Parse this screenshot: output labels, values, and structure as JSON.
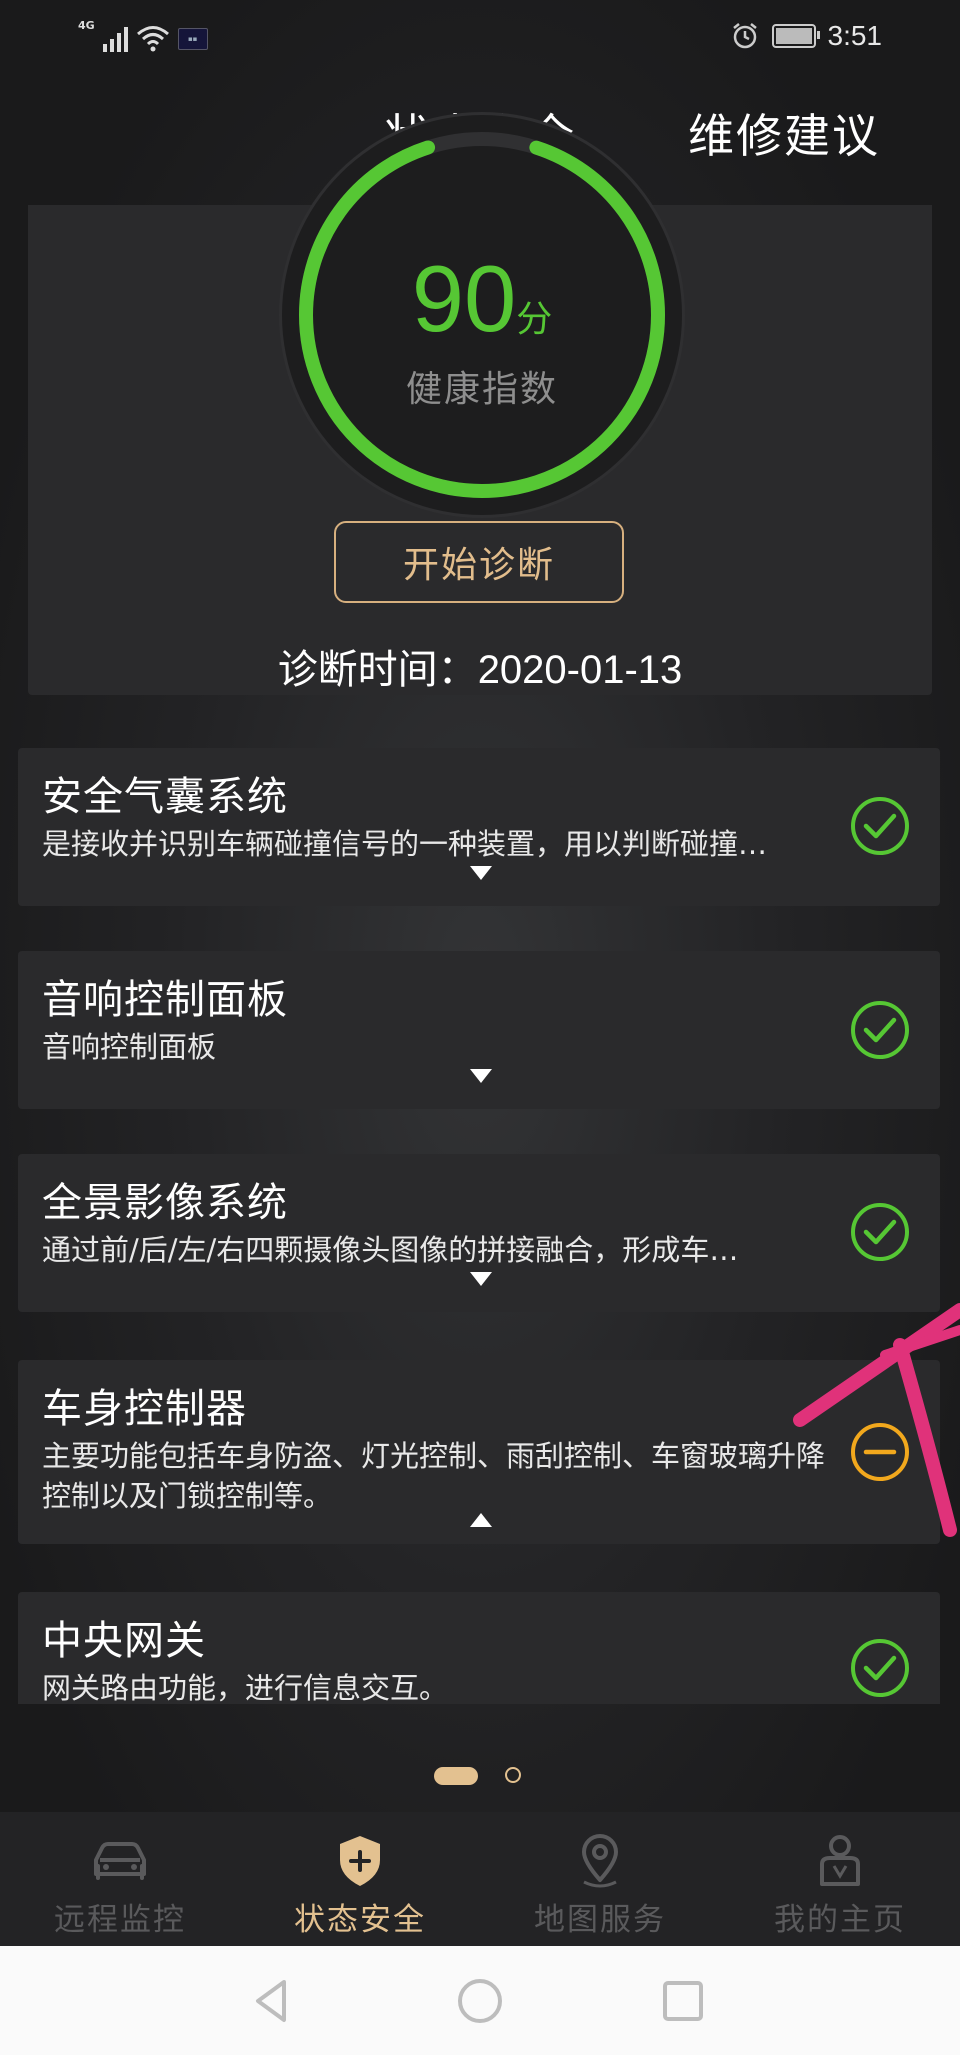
{
  "status_bar": {
    "network": "4G",
    "time": "3:51"
  },
  "top_tabs": [
    {
      "label": "状态安全"
    },
    {
      "label": "维修建议"
    }
  ],
  "health": {
    "score": "90",
    "unit": "分",
    "label": "健康指数",
    "progress": 0.9,
    "diagnose_button": "开始诊断",
    "diag_time_label": "诊断时间：",
    "diag_time_value": "2020-01-13"
  },
  "items": [
    {
      "title": "安全气囊系统",
      "desc": "是接收并识别车辆碰撞信号的一种装置，用以判断碰撞…",
      "status": "ok",
      "expanded": false
    },
    {
      "title": "音响控制面板",
      "desc": "音响控制面板",
      "status": "ok",
      "expanded": false
    },
    {
      "title": "全景影像系统",
      "desc": "通过前/后/左/右四颗摄像头图像的拼接融合，形成车…",
      "status": "ok",
      "expanded": false
    },
    {
      "title": "车身控制器",
      "desc": "主要功能包括车身防盗、灯光控制、雨刮控制、车窗玻璃升降控制以及门锁控制等。",
      "status": "warning",
      "expanded": true
    },
    {
      "title": "中央网关",
      "desc": "网关路由功能，进行信息交互。",
      "status": "ok",
      "expanded": false
    }
  ],
  "pager": {
    "pages": 2,
    "current": 1
  },
  "bottom_nav": [
    {
      "label": "远程监控",
      "icon": "car-icon"
    },
    {
      "label": "状态安全",
      "icon": "shield-plus-icon"
    },
    {
      "label": "地图服务",
      "icon": "map-pin-icon"
    },
    {
      "label": "我的主页",
      "icon": "person-icon"
    }
  ],
  "colors": {
    "accent": "#e3c190",
    "ok": "#56c734",
    "warning": "#f2a81d",
    "annotation": "#e0327a"
  }
}
